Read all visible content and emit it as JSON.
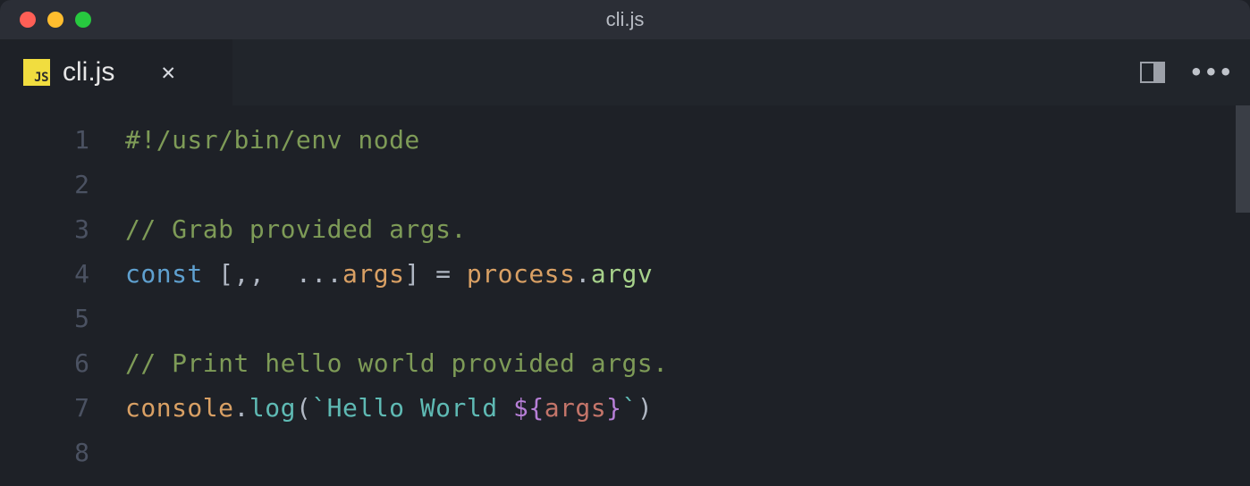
{
  "window": {
    "title": "cli.js"
  },
  "tab": {
    "icon_label": "JS",
    "filename": "cli.js",
    "close_glyph": "✕"
  },
  "actions": {
    "more_glyph": "•••"
  },
  "gutter": [
    "1",
    "2",
    "3",
    "4",
    "5",
    "6",
    "7",
    "8"
  ],
  "code": {
    "l1_shebang": "#!/usr/bin/env node",
    "l3_comment": "// Grab provided args.",
    "l4_const": "const",
    "l4_bracket_open": " [,,  ...",
    "l4_args": "args",
    "l4_bracket_close": "] = ",
    "l4_process": "process",
    "l4_dot": ".",
    "l4_argv": "argv",
    "l6_comment": "// Print hello world provided args.",
    "l7_console": "console",
    "l7_dot": ".",
    "l7_log": "log",
    "l7_paren_open": "(",
    "l7_backtick1": "`",
    "l7_str": "Hello World ",
    "l7_interp_open": "${",
    "l7_interp_var": "args",
    "l7_interp_close": "}",
    "l7_backtick2": "`",
    "l7_paren_close": ")"
  }
}
